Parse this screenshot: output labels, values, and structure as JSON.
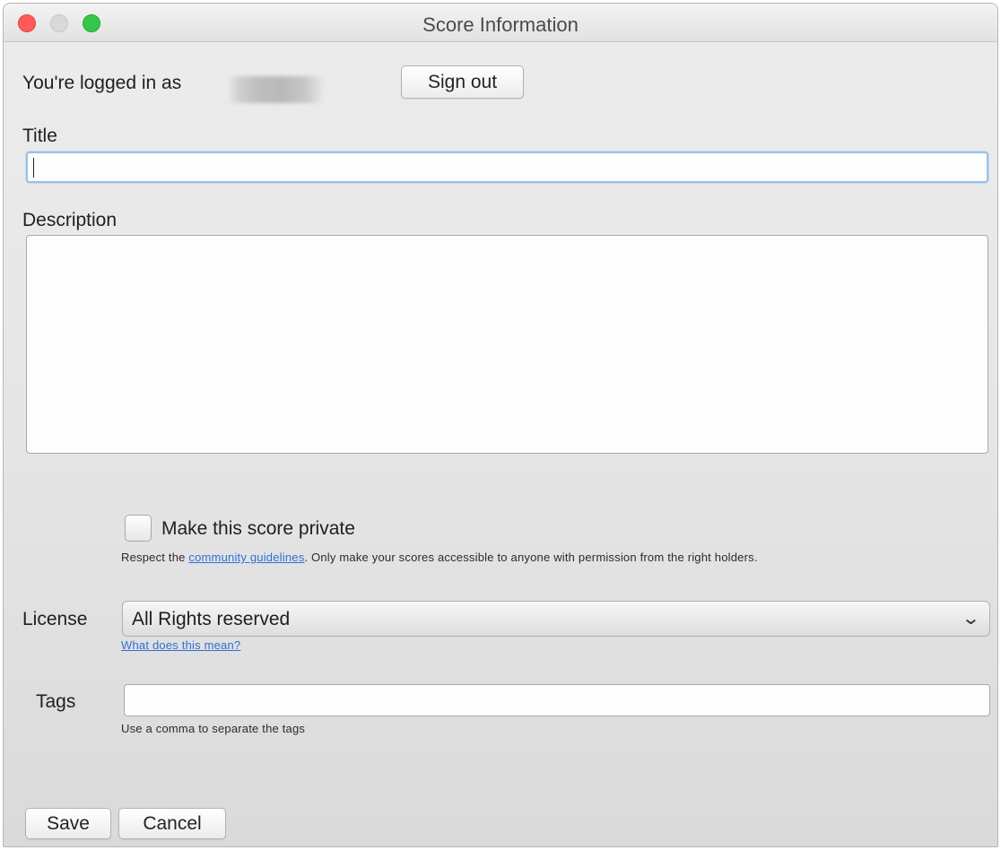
{
  "window": {
    "title": "Score Information"
  },
  "account": {
    "logged_in_label": "You're logged in as",
    "sign_out_label": "Sign out"
  },
  "form": {
    "title_label": "Title",
    "title_value": "",
    "description_label": "Description",
    "description_value": "",
    "private_checkbox_label": "Make this score private",
    "private_checked": false,
    "guidelines_prefix": "Respect the ",
    "guidelines_link": "community guidelines",
    "guidelines_suffix": ". Only make your scores accessible to anyone with permission from the right holders.",
    "license_label": "License",
    "license_selected": "All Rights reserved",
    "license_help_link": "What does this mean?",
    "tags_label": "Tags",
    "tags_value": "",
    "tags_hint": "Use a comma to separate the tags"
  },
  "actions": {
    "save_label": "Save",
    "cancel_label": "Cancel"
  }
}
